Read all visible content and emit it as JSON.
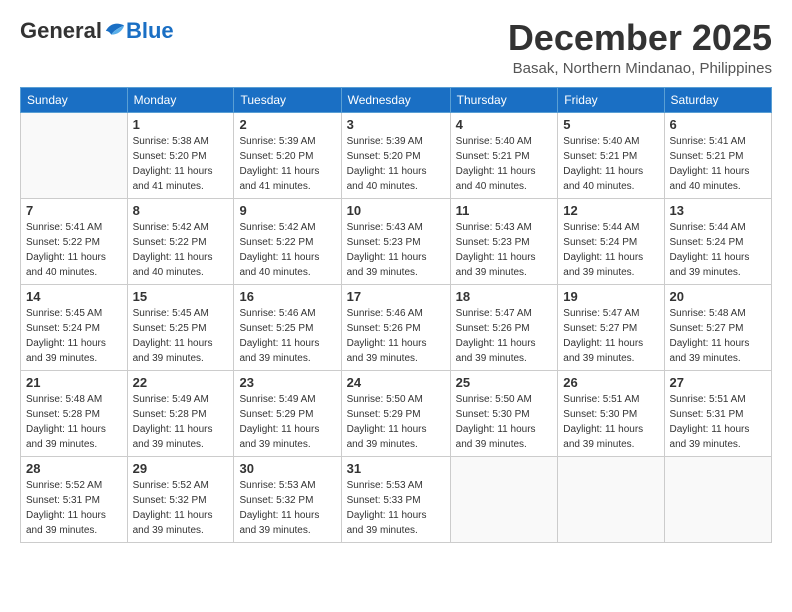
{
  "logo": {
    "general": "General",
    "blue": "Blue"
  },
  "header": {
    "title": "December 2025",
    "subtitle": "Basak, Northern Mindanao, Philippines"
  },
  "weekdays": [
    "Sunday",
    "Monday",
    "Tuesday",
    "Wednesday",
    "Thursday",
    "Friday",
    "Saturday"
  ],
  "weeks": [
    [
      {
        "day": "",
        "sunrise": "",
        "sunset": "",
        "daylight": ""
      },
      {
        "day": "1",
        "sunrise": "Sunrise: 5:38 AM",
        "sunset": "Sunset: 5:20 PM",
        "daylight": "Daylight: 11 hours and 41 minutes."
      },
      {
        "day": "2",
        "sunrise": "Sunrise: 5:39 AM",
        "sunset": "Sunset: 5:20 PM",
        "daylight": "Daylight: 11 hours and 41 minutes."
      },
      {
        "day": "3",
        "sunrise": "Sunrise: 5:39 AM",
        "sunset": "Sunset: 5:20 PM",
        "daylight": "Daylight: 11 hours and 40 minutes."
      },
      {
        "day": "4",
        "sunrise": "Sunrise: 5:40 AM",
        "sunset": "Sunset: 5:21 PM",
        "daylight": "Daylight: 11 hours and 40 minutes."
      },
      {
        "day": "5",
        "sunrise": "Sunrise: 5:40 AM",
        "sunset": "Sunset: 5:21 PM",
        "daylight": "Daylight: 11 hours and 40 minutes."
      },
      {
        "day": "6",
        "sunrise": "Sunrise: 5:41 AM",
        "sunset": "Sunset: 5:21 PM",
        "daylight": "Daylight: 11 hours and 40 minutes."
      }
    ],
    [
      {
        "day": "7",
        "sunrise": "Sunrise: 5:41 AM",
        "sunset": "Sunset: 5:22 PM",
        "daylight": "Daylight: 11 hours and 40 minutes."
      },
      {
        "day": "8",
        "sunrise": "Sunrise: 5:42 AM",
        "sunset": "Sunset: 5:22 PM",
        "daylight": "Daylight: 11 hours and 40 minutes."
      },
      {
        "day": "9",
        "sunrise": "Sunrise: 5:42 AM",
        "sunset": "Sunset: 5:22 PM",
        "daylight": "Daylight: 11 hours and 40 minutes."
      },
      {
        "day": "10",
        "sunrise": "Sunrise: 5:43 AM",
        "sunset": "Sunset: 5:23 PM",
        "daylight": "Daylight: 11 hours and 39 minutes."
      },
      {
        "day": "11",
        "sunrise": "Sunrise: 5:43 AM",
        "sunset": "Sunset: 5:23 PM",
        "daylight": "Daylight: 11 hours and 39 minutes."
      },
      {
        "day": "12",
        "sunrise": "Sunrise: 5:44 AM",
        "sunset": "Sunset: 5:24 PM",
        "daylight": "Daylight: 11 hours and 39 minutes."
      },
      {
        "day": "13",
        "sunrise": "Sunrise: 5:44 AM",
        "sunset": "Sunset: 5:24 PM",
        "daylight": "Daylight: 11 hours and 39 minutes."
      }
    ],
    [
      {
        "day": "14",
        "sunrise": "Sunrise: 5:45 AM",
        "sunset": "Sunset: 5:24 PM",
        "daylight": "Daylight: 11 hours and 39 minutes."
      },
      {
        "day": "15",
        "sunrise": "Sunrise: 5:45 AM",
        "sunset": "Sunset: 5:25 PM",
        "daylight": "Daylight: 11 hours and 39 minutes."
      },
      {
        "day": "16",
        "sunrise": "Sunrise: 5:46 AM",
        "sunset": "Sunset: 5:25 PM",
        "daylight": "Daylight: 11 hours and 39 minutes."
      },
      {
        "day": "17",
        "sunrise": "Sunrise: 5:46 AM",
        "sunset": "Sunset: 5:26 PM",
        "daylight": "Daylight: 11 hours and 39 minutes."
      },
      {
        "day": "18",
        "sunrise": "Sunrise: 5:47 AM",
        "sunset": "Sunset: 5:26 PM",
        "daylight": "Daylight: 11 hours and 39 minutes."
      },
      {
        "day": "19",
        "sunrise": "Sunrise: 5:47 AM",
        "sunset": "Sunset: 5:27 PM",
        "daylight": "Daylight: 11 hours and 39 minutes."
      },
      {
        "day": "20",
        "sunrise": "Sunrise: 5:48 AM",
        "sunset": "Sunset: 5:27 PM",
        "daylight": "Daylight: 11 hours and 39 minutes."
      }
    ],
    [
      {
        "day": "21",
        "sunrise": "Sunrise: 5:48 AM",
        "sunset": "Sunset: 5:28 PM",
        "daylight": "Daylight: 11 hours and 39 minutes."
      },
      {
        "day": "22",
        "sunrise": "Sunrise: 5:49 AM",
        "sunset": "Sunset: 5:28 PM",
        "daylight": "Daylight: 11 hours and 39 minutes."
      },
      {
        "day": "23",
        "sunrise": "Sunrise: 5:49 AM",
        "sunset": "Sunset: 5:29 PM",
        "daylight": "Daylight: 11 hours and 39 minutes."
      },
      {
        "day": "24",
        "sunrise": "Sunrise: 5:50 AM",
        "sunset": "Sunset: 5:29 PM",
        "daylight": "Daylight: 11 hours and 39 minutes."
      },
      {
        "day": "25",
        "sunrise": "Sunrise: 5:50 AM",
        "sunset": "Sunset: 5:30 PM",
        "daylight": "Daylight: 11 hours and 39 minutes."
      },
      {
        "day": "26",
        "sunrise": "Sunrise: 5:51 AM",
        "sunset": "Sunset: 5:30 PM",
        "daylight": "Daylight: 11 hours and 39 minutes."
      },
      {
        "day": "27",
        "sunrise": "Sunrise: 5:51 AM",
        "sunset": "Sunset: 5:31 PM",
        "daylight": "Daylight: 11 hours and 39 minutes."
      }
    ],
    [
      {
        "day": "28",
        "sunrise": "Sunrise: 5:52 AM",
        "sunset": "Sunset: 5:31 PM",
        "daylight": "Daylight: 11 hours and 39 minutes."
      },
      {
        "day": "29",
        "sunrise": "Sunrise: 5:52 AM",
        "sunset": "Sunset: 5:32 PM",
        "daylight": "Daylight: 11 hours and 39 minutes."
      },
      {
        "day": "30",
        "sunrise": "Sunrise: 5:53 AM",
        "sunset": "Sunset: 5:32 PM",
        "daylight": "Daylight: 11 hours and 39 minutes."
      },
      {
        "day": "31",
        "sunrise": "Sunrise: 5:53 AM",
        "sunset": "Sunset: 5:33 PM",
        "daylight": "Daylight: 11 hours and 39 minutes."
      },
      {
        "day": "",
        "sunrise": "",
        "sunset": "",
        "daylight": ""
      },
      {
        "day": "",
        "sunrise": "",
        "sunset": "",
        "daylight": ""
      },
      {
        "day": "",
        "sunrise": "",
        "sunset": "",
        "daylight": ""
      }
    ]
  ]
}
